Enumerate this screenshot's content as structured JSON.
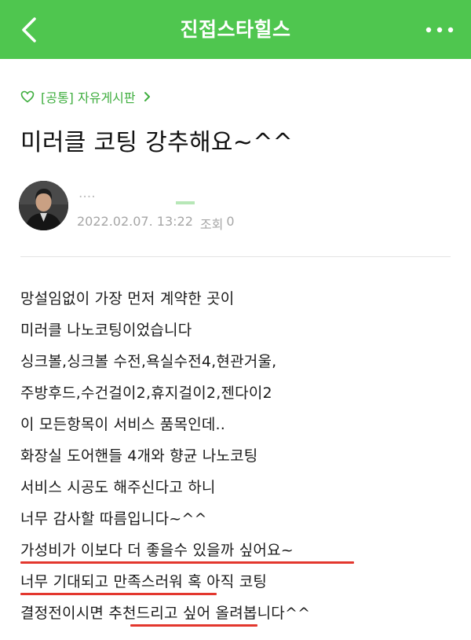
{
  "header": {
    "title": "진접스타힐스",
    "back_icon": "chevron-left-icon",
    "more_icon": "more-horizontal-icon",
    "background_color": "#4fc64f"
  },
  "board": {
    "label": "[공통] 자유게시판",
    "icon": "heart-outline-icon",
    "accent_color": "#3fae3f"
  },
  "post": {
    "title": "미러클 코팅 강추해요~^^",
    "author": {
      "avatar_icon": "profile-photo",
      "name": "...."
    },
    "date": "2022.02.07. 13:22",
    "views_label": "조회",
    "views_count": "0",
    "lines": [
      "망설임없이 가장 먼저 계약한 곳이",
      "미러클 나노코팅이었습니다",
      "싱크볼,싱크볼 수전,욕실수전4,현관거울,",
      "주방후드,수건걸이2,휴지걸이2,젠다이2",
      "이 모든항목이 서비스 품목인데..",
      "화장실 도어핸들 4개와 향균 나노코팅",
      "서비스 시공도 해주신다고 하니",
      "너무 감사할 따름입니다~^^",
      "가성비가 이보다 더 좋을수 있을까 싶어요~",
      "너무 기대되고 만족스러워 혹 아직 코팅",
      "결정전이시면 추천드리고 싶어 올려봅니다^^"
    ],
    "highlight_color": "#e3372e"
  }
}
